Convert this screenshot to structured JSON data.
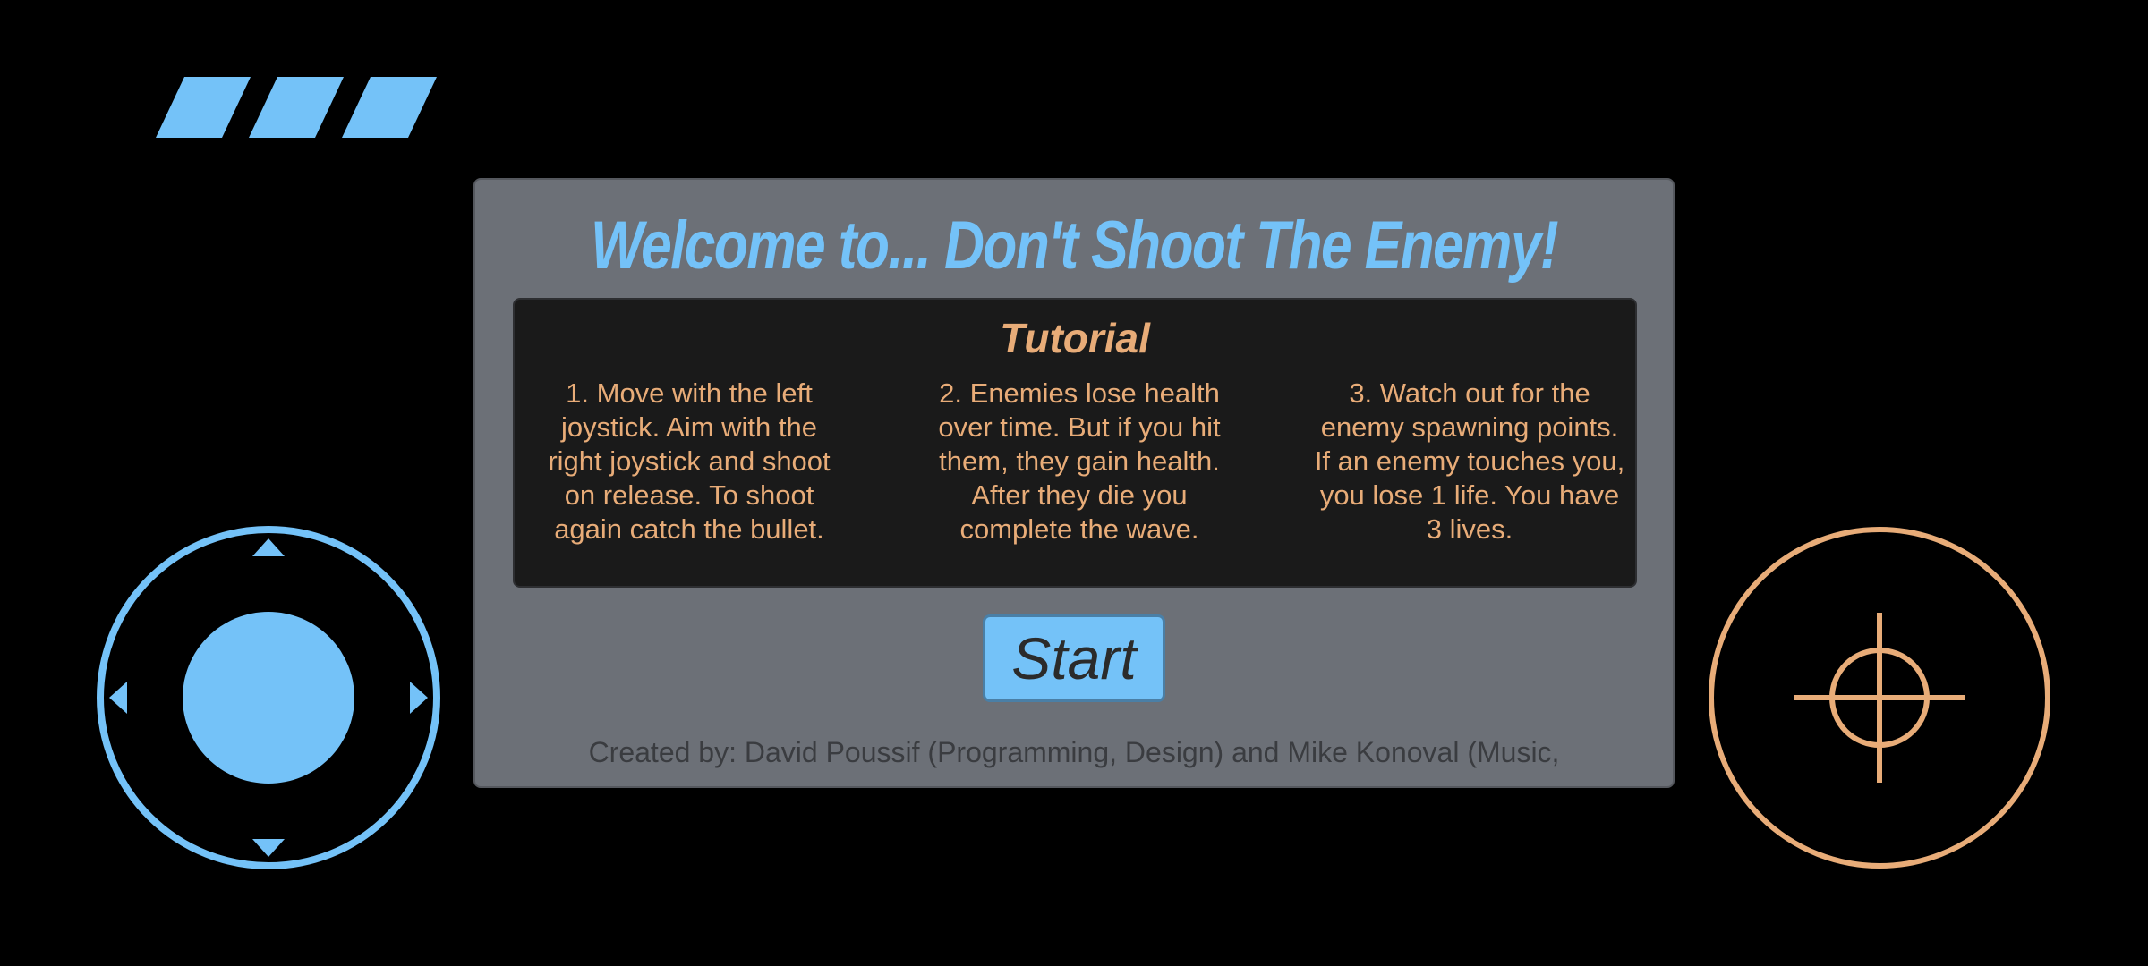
{
  "colors": {
    "background": "#000000",
    "accent_blue": "#74c2f8",
    "accent_orange": "#e8ac78",
    "panel": "#6c7077",
    "tutorial_box": "#1a1a1a",
    "credits_text": "#3a3c40"
  },
  "hud": {
    "lives": 3,
    "lives_max": 3,
    "lives_icon": "parallelogram-life-bar",
    "move_joystick_icon": "dpad-joystick-icon",
    "aim_joystick_icon": "crosshair-icon"
  },
  "menu": {
    "title": "Welcome to... Don't Shoot The Enemy!",
    "tutorial": {
      "heading": "Tutorial",
      "steps": [
        "1. Move with the left joystick. Aim with the right joystick and shoot on release. To shoot again catch the bullet.",
        "2. Enemies lose health over time. But if you hit them, they gain health. After they die you complete the wave.",
        "3. Watch out for the enemy spawning points. If an enemy touches you, you lose 1 life. You have 3 lives."
      ]
    },
    "start_label": "Start",
    "credits": "Created by: David Poussif (Programming, Design) and Mike Konoval (Music,"
  }
}
